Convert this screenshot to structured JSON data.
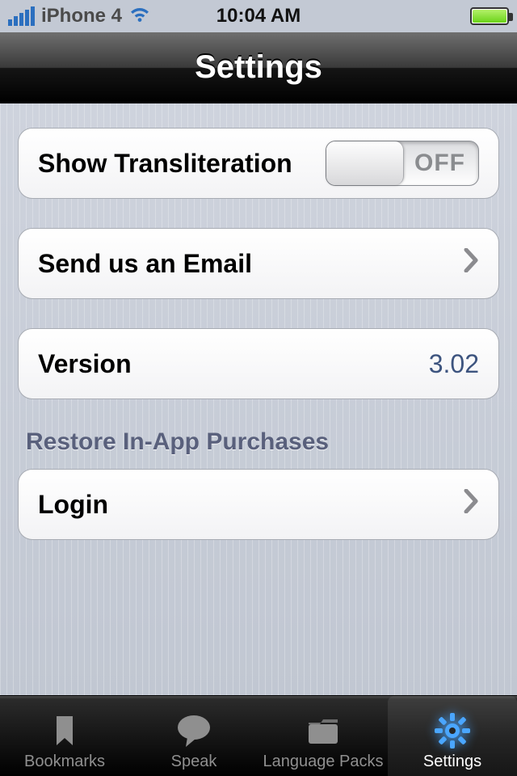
{
  "status": {
    "carrier": "iPhone 4",
    "time": "10:04 AM"
  },
  "nav": {
    "title": "Settings"
  },
  "rows": {
    "transliteration": {
      "label": "Show Transliteration",
      "toggle": "OFF"
    },
    "email": {
      "label": "Send us an Email"
    },
    "version": {
      "label": "Version",
      "value": "3.02"
    },
    "login": {
      "label": "Login"
    }
  },
  "section_restore": "Restore In-App Purchases",
  "tabs": {
    "bookmarks": "Bookmarks",
    "speak": "Speak",
    "language": "Language Packs",
    "settings": "Settings"
  }
}
